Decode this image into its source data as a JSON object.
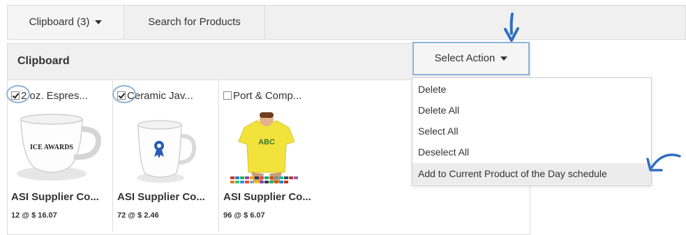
{
  "tabs": {
    "clipboard_label": "Clipboard (3)",
    "search_label": "Search for Products"
  },
  "panel": {
    "title": "Clipboard",
    "select_action_label": "Select Action"
  },
  "dropdown": {
    "items": [
      {
        "label": "Delete"
      },
      {
        "label": "Delete All"
      },
      {
        "label": "Select All"
      },
      {
        "label": "Deselect All"
      },
      {
        "label": "Add to Current Product of the Day schedule"
      }
    ]
  },
  "products": [
    {
      "title": "2 oz. Espres...",
      "checked": true,
      "supplier": "ASI Supplier Co...",
      "price": "12 @ $ 16.07",
      "image": "white-espresso-cup-icon"
    },
    {
      "title": "Ceramic Jav...",
      "checked": true,
      "supplier": "ASI Supplier Co...",
      "price": "72 @ $ 2.46",
      "image": "white-ceramic-mug-icon"
    },
    {
      "title": "Port & Comp...",
      "checked": false,
      "supplier": "ASI Supplier Co...",
      "price": "96 @ $ 6.07",
      "image": "yellow-tshirt-icon"
    }
  ],
  "cup_imprint": "ICE AWARDS",
  "shirt_imprint": "ABC",
  "colors": {
    "accent": "#8fb3d9",
    "arrow": "#2f6fc2",
    "mug_ribbon": "#2a5bb5",
    "shirt": "#f2e23c"
  }
}
